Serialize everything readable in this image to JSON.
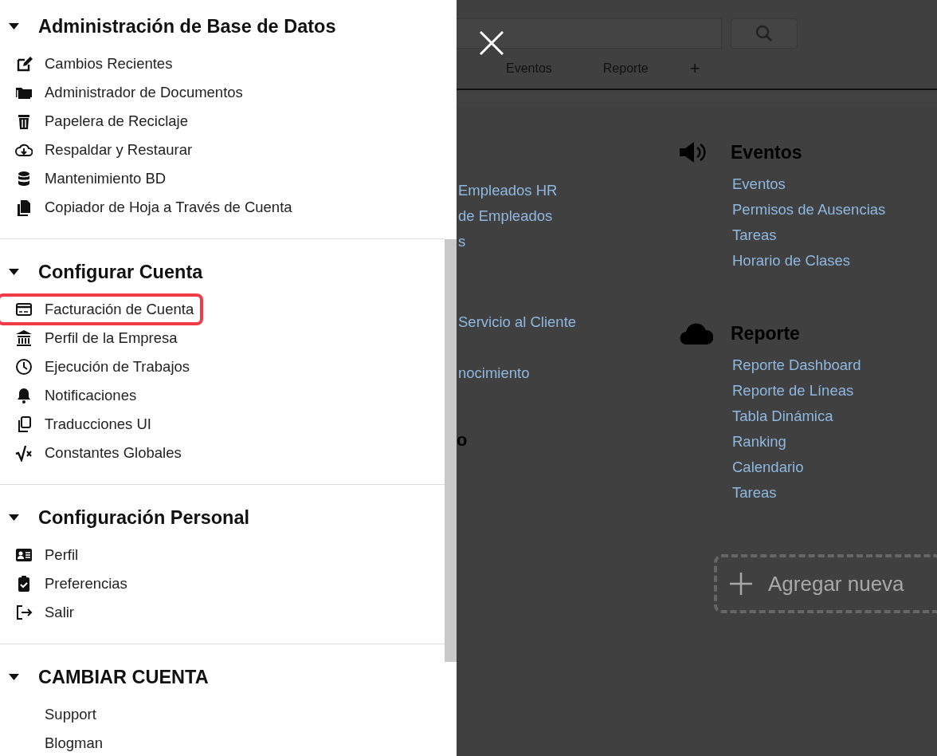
{
  "drawer": {
    "sections": [
      {
        "title": "Administración de Base de Datos",
        "expanded": true,
        "items": [
          {
            "label": "Cambios Recientes",
            "highlighted": false
          },
          {
            "label": "Administrador de Documentos",
            "highlighted": false
          },
          {
            "label": "Papelera de Reciclaje",
            "highlighted": false
          },
          {
            "label": "Respaldar y Restaurar",
            "highlighted": false
          },
          {
            "label": "Mantenimiento BD",
            "highlighted": false
          },
          {
            "label": "Copiador de Hoja a Través de Cuenta",
            "highlighted": false
          }
        ]
      },
      {
        "title": "Configurar Cuenta",
        "expanded": true,
        "items": [
          {
            "label": "Facturación de Cuenta",
            "highlighted": true
          },
          {
            "label": "Perfil de la Empresa",
            "highlighted": false
          },
          {
            "label": "Ejecución de Trabajos",
            "highlighted": false
          },
          {
            "label": "Notificaciones",
            "highlighted": false
          },
          {
            "label": "Traducciones UI",
            "highlighted": false
          },
          {
            "label": "Constantes Globales",
            "highlighted": false
          }
        ]
      },
      {
        "title": "Configuración Personal",
        "expanded": true,
        "items": [
          {
            "label": "Perfil",
            "highlighted": false
          },
          {
            "label": "Preferencias",
            "highlighted": false
          },
          {
            "label": "Salir",
            "highlighted": false
          }
        ]
      },
      {
        "title": "CAMBIAR CUENTA",
        "expanded": true,
        "items": [
          {
            "label": "Support",
            "highlighted": false
          },
          {
            "label": "Blogman",
            "highlighted": false
          }
        ]
      }
    ]
  },
  "background": {
    "tabs": [
      {
        "label": "Eventos"
      },
      {
        "label": "Reporte"
      },
      {
        "label": "+"
      }
    ],
    "left_column": [
      {
        "kind": "links",
        "items": [
          "Empleados HR",
          "de Empleados",
          "s"
        ]
      },
      {
        "kind": "links",
        "items": [
          "Servicio al Cliente",
          "nocimiento"
        ]
      },
      {
        "kind": "heading",
        "items": [
          "o"
        ]
      }
    ],
    "cards": [
      {
        "title": "Eventos",
        "links": [
          "Eventos",
          "Permisos de Ausencias",
          "Tareas",
          "Horario de Clases"
        ]
      },
      {
        "title": "Reporte",
        "links": [
          "Reporte Dashboard",
          "Reporte de Líneas",
          "Tabla Dinámica",
          "Ranking",
          "Calendario",
          "Tareas"
        ]
      }
    ],
    "add_button": "Agregar nueva"
  }
}
